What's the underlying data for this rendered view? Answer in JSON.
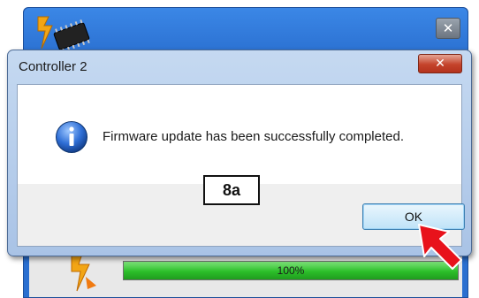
{
  "background_window": {
    "close_glyph": "✕",
    "progress": {
      "value": 1.0,
      "label": "100%"
    }
  },
  "dialog": {
    "title": "Controller 2",
    "close_glyph": "✕",
    "message": "Firmware update has been successfully completed.",
    "ok_label": "OK"
  },
  "annotation": {
    "step_label": "8a"
  },
  "colors": {
    "accent_red_arrow": "#e8121b",
    "progress_green": "#2cbf2a"
  },
  "icons": {
    "dialog_icon": "info-icon",
    "app_icon": "chip-lightning-icon",
    "pointer": "red-arrow-icon"
  }
}
